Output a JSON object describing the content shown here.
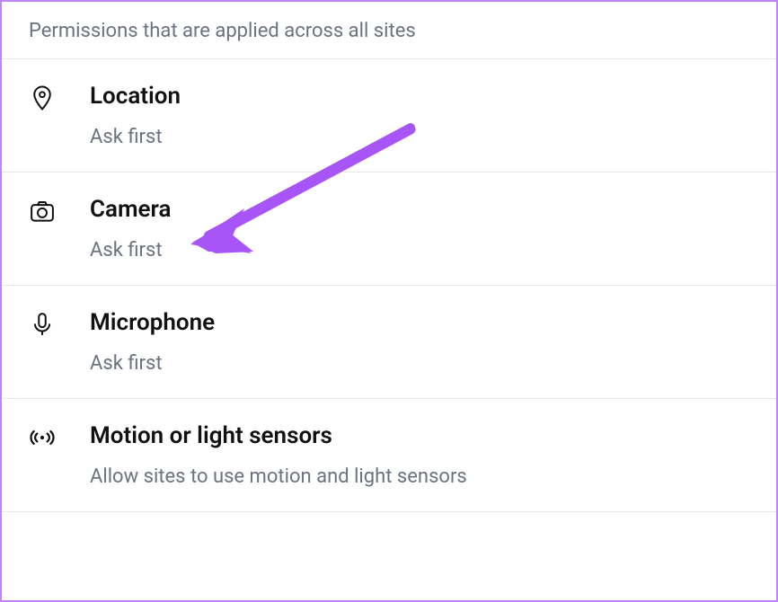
{
  "header": "Permissions that are applied across all sites",
  "permissions": [
    {
      "title": "Location",
      "subtitle": "Ask first"
    },
    {
      "title": "Camera",
      "subtitle": "Ask first"
    },
    {
      "title": "Microphone",
      "subtitle": "Ask first"
    },
    {
      "title": "Motion or light sensors",
      "subtitle": "Allow sites to use motion and light sensors"
    }
  ],
  "annotation": {
    "arrow_color": "#a855f7"
  }
}
